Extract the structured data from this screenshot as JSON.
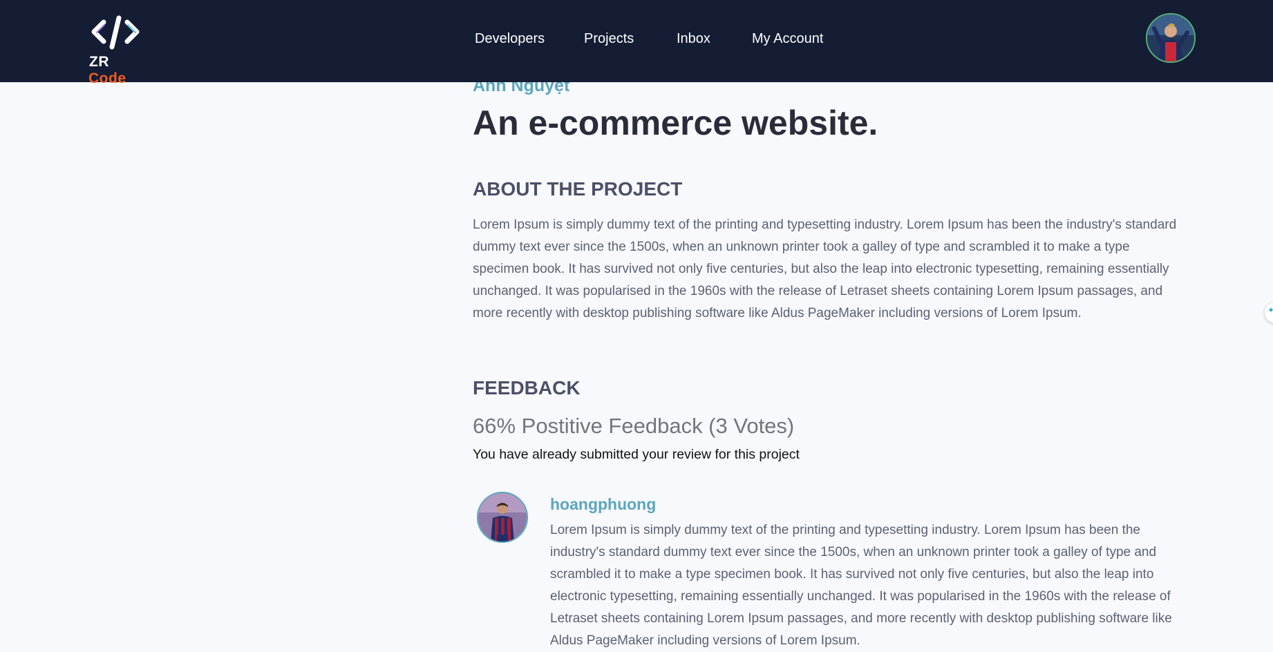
{
  "brand": {
    "logo_prefix": "ZR",
    "logo_suffix": "Code",
    "accent": "#f25b22"
  },
  "nav": {
    "items": [
      {
        "label": "Developers"
      },
      {
        "label": "Projects"
      },
      {
        "label": "Inbox"
      },
      {
        "label": "My Account"
      }
    ]
  },
  "project": {
    "author": "Anh Nguyệt",
    "title": "An e-commerce website.",
    "about_heading": "ABOUT THE PROJECT",
    "about_text": "Lorem Ipsum is simply dummy text of the printing and typesetting industry. Lorem Ipsum has been the industry's standard dummy text ever since the 1500s, when an unknown printer took a galley of type and scrambled it to make a type specimen book. It has survived not only five centuries, but also the leap into electronic typesetting, remaining essentially unchanged. It was popularised in the 1960s with the release of Letraset sheets containing Lorem Ipsum passages, and more recently with desktop publishing software like Aldus PageMaker including versions of Lorem Ipsum."
  },
  "feedback": {
    "heading": "FEEDBACK",
    "stat": "66% Postitive Feedback (3 Votes)",
    "submitted_note": "You have already submitted your review for this project",
    "reviews": [
      {
        "username": "hoangphuong",
        "text": "Lorem Ipsum is simply dummy text of the printing and typesetting industry. Lorem Ipsum has been the industry's standard dummy text ever since the 1500s, when an unknown printer took a galley of type and scrambled it to make a type specimen book. It has survived not only five centuries, but also the leap into electronic typesetting, remaining essentially unchanged. It was popularised in the 1960s with the release of Letraset sheets containing Lorem Ipsum passages, and more recently with desktop publishing software like Aldus PageMaker including versions of Lorem Ipsum."
      }
    ]
  },
  "colors": {
    "navbar": "#141d33",
    "link": "#5aa6bd",
    "heading": "#2a2c3a",
    "body_text": "#5b6074"
  },
  "icons": {
    "logo": "code-brackets-icon",
    "side_widget": "sparkle-icon"
  }
}
